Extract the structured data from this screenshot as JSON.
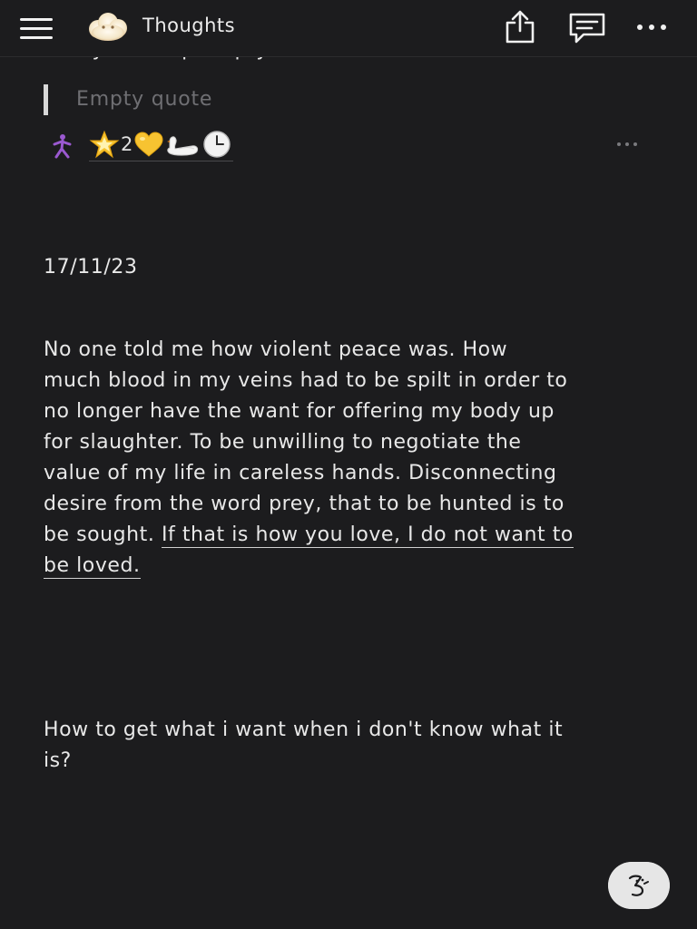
{
  "header": {
    "title": "Thoughts",
    "icons": [
      "menu-icon",
      "cloud-emoji-icon",
      "share-icon",
      "comment-icon",
      "more-icon"
    ]
  },
  "content": {
    "cut_text": "always end up empty.",
    "quote_placeholder": "Empty quote",
    "reactions": {
      "icons": [
        "person-walking-icon",
        "star-emoji",
        "yellow-heart-emoji",
        "swan-emoji",
        "clock-emoji"
      ],
      "star_count": "2"
    },
    "date": "17/11/23",
    "paragraph": {
      "line1": "No one told me how violent peace was. How",
      "line2": "much blood in my veins had to be spilt in order to",
      "line3": "no longer have the want for offering my body up",
      "line4": "for slaughter. To be unwilling to negotiate the",
      "line5": "value of my life in careless hands. Disconnecting",
      "line6": "desire from the word prey, that to be hunted is to",
      "line7_plain": "be sought. ",
      "line7_link": "If that is how you love, I do not want to",
      "line8_link": "be loved."
    },
    "question": {
      "line1": "How to get what i want when i don't know what it",
      "line2": "is?"
    }
  },
  "colors": {
    "background": "#1c1c1e",
    "text": "#e8e8e8",
    "muted": "#6f6f73",
    "accent_purple": "#9b59d0"
  }
}
